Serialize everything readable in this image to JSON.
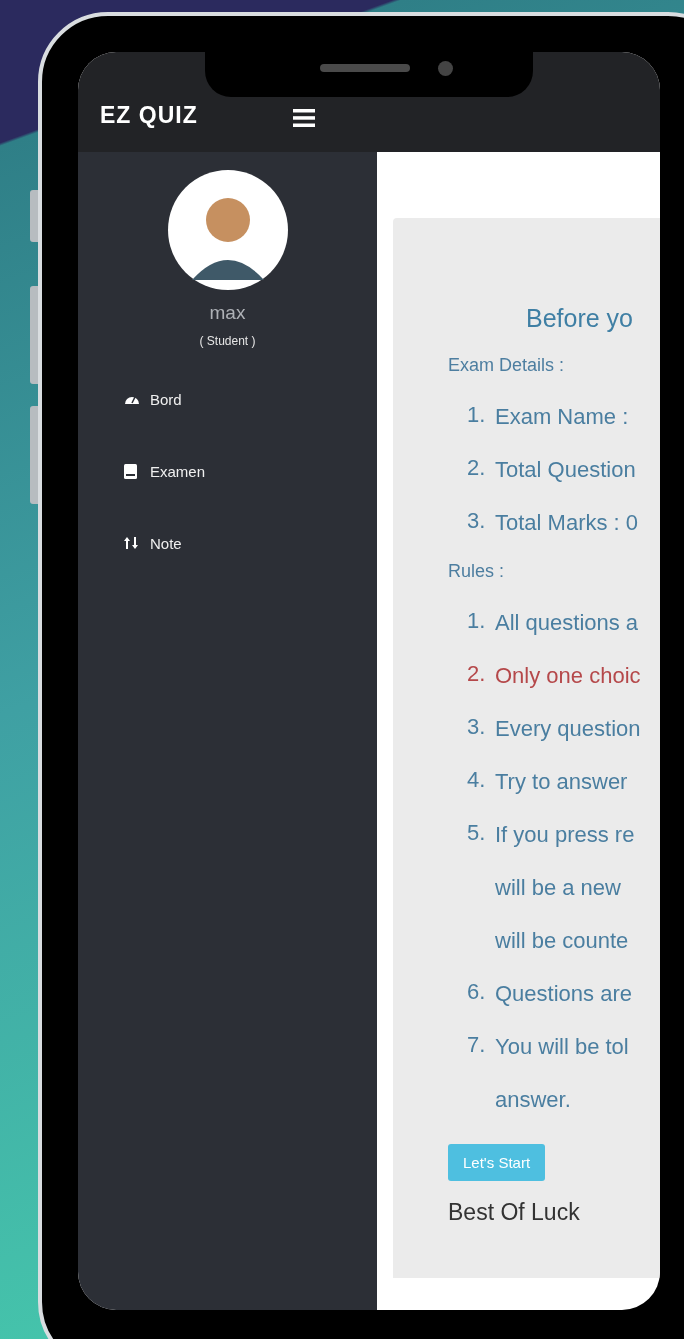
{
  "app": {
    "title": "EZ QUIZ"
  },
  "profile": {
    "name": "max",
    "role": "( Student )"
  },
  "sidebar": {
    "items": [
      {
        "label": "Bord"
      },
      {
        "label": "Examen"
      },
      {
        "label": "Note"
      }
    ]
  },
  "main": {
    "heading": "Before yo",
    "sections": [
      {
        "title": "Exam Details :",
        "items": [
          {
            "number": "1.",
            "lines": [
              "Exam Name :"
            ],
            "highlighted": false
          },
          {
            "number": "2.",
            "lines": [
              "Total Question"
            ],
            "highlighted": false
          },
          {
            "number": "3.",
            "lines": [
              "Total Marks : 0"
            ],
            "highlighted": false
          }
        ]
      },
      {
        "title": "Rules :",
        "items": [
          {
            "number": "1.",
            "lines": [
              "All questions a"
            ],
            "highlighted": false
          },
          {
            "number": "2.",
            "lines": [
              "Only one choic"
            ],
            "highlighted": true
          },
          {
            "number": "3.",
            "lines": [
              "Every question"
            ],
            "highlighted": false
          },
          {
            "number": "4.",
            "lines": [
              "Try to answer"
            ],
            "highlighted": false
          },
          {
            "number": "5.",
            "lines": [
              "If you press re",
              "will be a new",
              "will be counte"
            ],
            "highlighted": false
          },
          {
            "number": "6.",
            "lines": [
              "Questions are"
            ],
            "highlighted": false
          },
          {
            "number": "7.",
            "lines": [
              "You will be tol",
              "answer."
            ],
            "highlighted": false
          }
        ]
      }
    ],
    "button": "Let's Start",
    "footer": "Best Of Luck"
  }
}
